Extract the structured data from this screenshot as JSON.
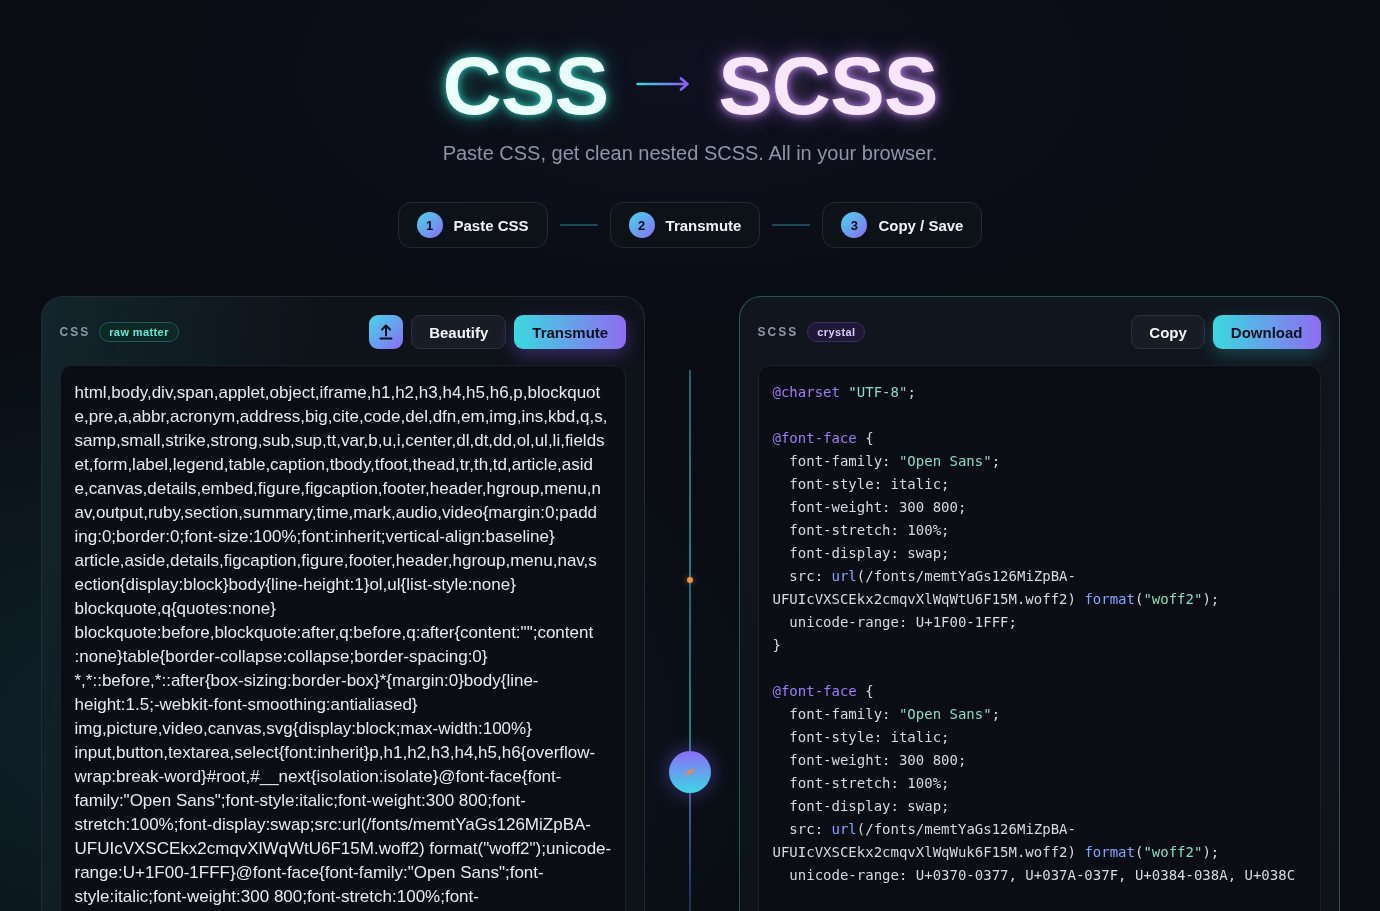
{
  "header": {
    "title_source": "CSS",
    "title_target": "SCSS",
    "subtitle": "Paste CSS, get clean nested SCSS. All in your browser."
  },
  "steps": [
    {
      "number": "1",
      "label": "Paste CSS"
    },
    {
      "number": "2",
      "label": "Transmute"
    },
    {
      "number": "3",
      "label": "Copy / Save"
    }
  ],
  "input_panel": {
    "label": "CSS",
    "tag": "raw matter",
    "buttons": [
      {
        "kind": "icon"
      },
      {
        "kind": "secondary",
        "label": "Beautify"
      },
      {
        "kind": "primary",
        "label": "Transmute"
      }
    ],
    "lines": [
      "html,body,div,span,applet,object,iframe,h1,h2,h3,h4,h5,h6,p,blockquot",
      "e,pre,a,abbr,acronym,address,big,cite,code,del,dfn,em,img,ins,kbd,q,s,",
      "samp,small,strike,strong,sub,sup,tt,var,b,u,i,center,dl,dt,dd,ol,ul,li,fields",
      "et,form,label,legend,table,caption,tbody,tfoot,thead,tr,th,td,article,asid",
      "e,canvas,details,embed,figure,figcaption,footer,header,hgroup,menu,n",
      "av,output,ruby,section,summary,time,mark,audio,video{margin:0;padd",
      "ing:0;border:0;font-size:100%;font:inherit;vertical-align:baseline}",
      "article,aside,details,figcaption,figure,footer,header,hgroup,menu,nav,s",
      "ection{display:block}body{line-height:1}ol,ul{list-style:none}",
      "blockquote,q{quotes:none}",
      "blockquote:before,blockquote:after,q:before,q:after{content:\"\";content",
      ":none}table{border-collapse:collapse;border-spacing:0}",
      "*,*::before,*::after{box-sizing:border-box}*{margin:0}body{line-",
      "height:1.5;-webkit-font-smoothing:antialiased}",
      "img,picture,video,canvas,svg{display:block;max-width:100%}",
      "input,button,textarea,select{font:inherit}p,h1,h2,h3,h4,h5,h6{overflow-",
      "wrap:break-word}#root,#__next{isolation:isolate}@font-face{font-",
      "family:\"Open Sans\";font-style:italic;font-weight:300 800;font-",
      "stretch:100%;font-display:swap;src:url(/fonts/memtYaGs126MiZpBA-",
      "UFUIcVXSCEkx2cmqvXlWqWtU6F15M.woff2) format(\"woff2\");unicode-",
      "range:U+1F00-1FFF}@font-face{font-family:\"Open Sans\";font-",
      "style:italic;font-weight:300 800;font-stretch:100%;font-"
    ]
  },
  "output_panel": {
    "label": "SCSS",
    "tag": "crystal",
    "buttons": [
      {
        "kind": "secondary",
        "label": "Copy"
      },
      {
        "kind": "primary",
        "label": "Download"
      }
    ],
    "lines": [
      {
        "kind": "code",
        "tokens": [
          {
            "kind": "at",
            "text": "@charset"
          },
          {
            "kind": "string",
            "text": " \"UTF-8\""
          },
          {
            "kind": "plain",
            "text": ";"
          }
        ]
      },
      {
        "kind": "blank"
      },
      {
        "kind": "code",
        "tokens": [
          {
            "kind": "at",
            "text": "@font-face"
          },
          {
            "kind": "plain",
            "text": " {"
          }
        ]
      },
      {
        "kind": "code",
        "tokens": [
          {
            "kind": "plain",
            "text": "  font-family: "
          },
          {
            "kind": "string",
            "text": "\"Open Sans\""
          },
          {
            "kind": "plain",
            "text": ";"
          }
        ]
      },
      {
        "kind": "code",
        "tokens": [
          {
            "kind": "plain",
            "text": "  font-style: italic;"
          }
        ]
      },
      {
        "kind": "code",
        "tokens": [
          {
            "kind": "plain",
            "text": "  font-weight: 300 800;"
          }
        ]
      },
      {
        "kind": "code",
        "tokens": [
          {
            "kind": "plain",
            "text": "  font-stretch: 100%;"
          }
        ]
      },
      {
        "kind": "code",
        "tokens": [
          {
            "kind": "plain",
            "text": "  font-display: swap;"
          }
        ]
      },
      {
        "kind": "code",
        "tokens": [
          {
            "kind": "plain",
            "text": "  src: "
          },
          {
            "kind": "function",
            "text": "url"
          },
          {
            "kind": "plain",
            "text": "(/fonts/memtYaGs126MiZpBA-"
          }
        ]
      },
      {
        "kind": "code",
        "tokens": [
          {
            "kind": "plain",
            "text": "UFUIcVXSCEkx2cmqvXlWqWtU6F15M.woff2) "
          },
          {
            "kind": "function",
            "text": "format"
          },
          {
            "kind": "plain",
            "text": "("
          },
          {
            "kind": "string",
            "text": "\"woff2\""
          },
          {
            "kind": "plain",
            "text": ");"
          }
        ]
      },
      {
        "kind": "code",
        "tokens": [
          {
            "kind": "plain",
            "text": "  unicode-range: U+1F00-1FFF;"
          }
        ]
      },
      {
        "kind": "code",
        "tokens": [
          {
            "kind": "plain",
            "text": "}"
          }
        ]
      },
      {
        "kind": "blank"
      },
      {
        "kind": "code",
        "tokens": [
          {
            "kind": "at",
            "text": "@font-face"
          },
          {
            "kind": "plain",
            "text": " {"
          }
        ]
      },
      {
        "kind": "code",
        "tokens": [
          {
            "kind": "plain",
            "text": "  font-family: "
          },
          {
            "kind": "string",
            "text": "\"Open Sans\""
          },
          {
            "kind": "plain",
            "text": ";"
          }
        ]
      },
      {
        "kind": "code",
        "tokens": [
          {
            "kind": "plain",
            "text": "  font-style: italic;"
          }
        ]
      },
      {
        "kind": "code",
        "tokens": [
          {
            "kind": "plain",
            "text": "  font-weight: 300 800;"
          }
        ]
      },
      {
        "kind": "code",
        "tokens": [
          {
            "kind": "plain",
            "text": "  font-stretch: 100%;"
          }
        ]
      },
      {
        "kind": "code",
        "tokens": [
          {
            "kind": "plain",
            "text": "  font-display: swap;"
          }
        ]
      },
      {
        "kind": "code",
        "tokens": [
          {
            "kind": "plain",
            "text": "  src: "
          },
          {
            "kind": "function",
            "text": "url"
          },
          {
            "kind": "plain",
            "text": "(/fonts/memtYaGs126MiZpBA-"
          }
        ]
      },
      {
        "kind": "code",
        "tokens": [
          {
            "kind": "plain",
            "text": "UFUIcVXSCEkx2cmqvXlWqWuk6F15M.woff2) "
          },
          {
            "kind": "function",
            "text": "format"
          },
          {
            "kind": "plain",
            "text": "("
          },
          {
            "kind": "string",
            "text": "\"woff2\""
          },
          {
            "kind": "plain",
            "text": ");"
          }
        ]
      },
      {
        "kind": "code",
        "tokens": [
          {
            "kind": "plain",
            "text": "  unicode-range: U+0370-0377, U+037A-037F, U+0384-038A, U+038C"
          }
        ]
      }
    ]
  }
}
